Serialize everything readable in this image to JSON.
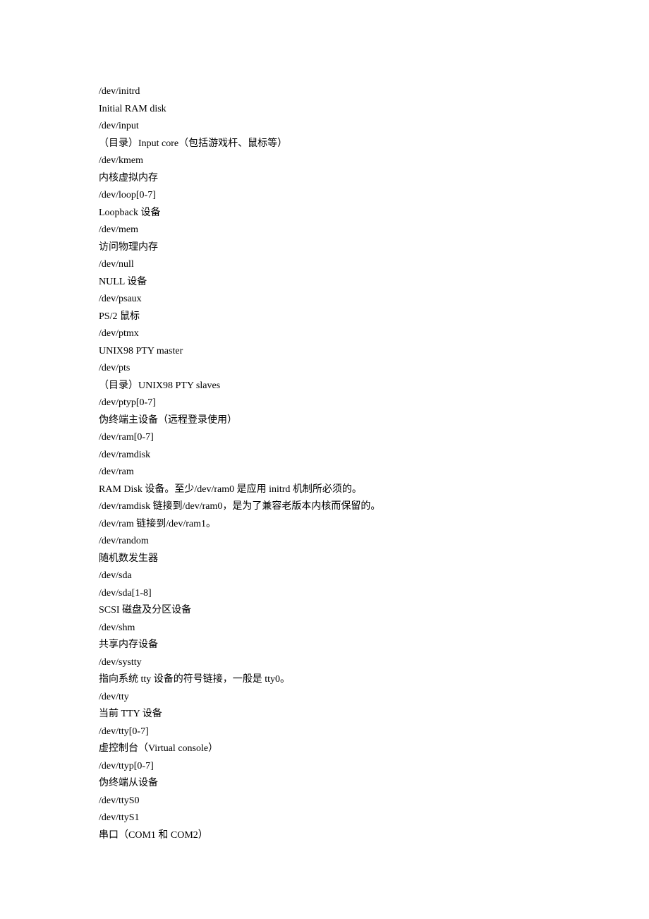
{
  "lines": [
    "/dev/initrd",
    "Initial RAM disk",
    "/dev/input",
    "（目录）Input core（包括游戏杆、鼠标等）",
    "/dev/kmem",
    "内核虚拟内存",
    "/dev/loop[0-7]",
    "Loopback 设备",
    "/dev/mem",
    "访问物理内存",
    "/dev/null",
    "NULL 设备",
    "/dev/psaux",
    "PS/2 鼠标",
    "/dev/ptmx",
    "UNIX98 PTY master",
    "/dev/pts",
    "（目录）UNIX98 PTY slaves",
    "/dev/ptyp[0-7]",
    "伪终端主设备（远程登录使用）",
    "/dev/ram[0-7]",
    "/dev/ramdisk",
    "/dev/ram",
    "RAM Disk 设备。至少/dev/ram0 是应用 initrd 机制所必须的。",
    "/dev/ramdisk 链接到/dev/ram0，是为了兼容老版本内核而保留的。",
    "/dev/ram 链接到/dev/ram1。",
    "/dev/random",
    "随机数发生器",
    "/dev/sda",
    "/dev/sda[1-8]",
    "SCSI 磁盘及分区设备",
    "/dev/shm",
    "共享内存设备",
    "/dev/systty",
    "指向系统 tty 设备的符号链接，一般是 tty0。",
    "/dev/tty",
    "当前 TTY 设备",
    "/dev/tty[0-7]",
    "虚控制台（Virtual console）",
    "/dev/ttyp[0-7]",
    "伪终端从设备",
    "/dev/ttyS0",
    "/dev/ttyS1",
    "串口（COM1 和 COM2）"
  ]
}
